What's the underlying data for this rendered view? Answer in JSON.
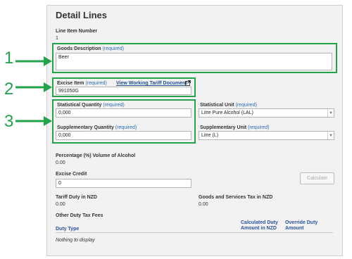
{
  "colors": {
    "annotation": "#23a34a",
    "required": "#2a6db5",
    "link": "#1f4f8f",
    "table_header": "#2a55a0"
  },
  "title": "Detail Lines",
  "line_item_number": {
    "label": "Line Item Number",
    "value": "1"
  },
  "required_text": "(required)",
  "goods_description": {
    "label": "Goods Description",
    "value": "Beer"
  },
  "excise_item": {
    "label": "Excise Item",
    "value": "991050G",
    "tariff_link": "View Working Tariff Document"
  },
  "statistical_quantity": {
    "label": "Statistical Quantity",
    "value": "0,000"
  },
  "supplementary_quantity": {
    "label": "Supplementary Quantity",
    "value": "0,000"
  },
  "statistical_unit": {
    "label": "Statistical Unit",
    "value": "Litre Pure Alcohol (LAL)"
  },
  "supplementary_unit": {
    "label": "Supplementary Unit",
    "value": "Litre (L)"
  },
  "percentage_alcohol": {
    "label": "Percentage (%) Volume of Alcohol",
    "value": "0.00"
  },
  "excise_credit": {
    "label": "Excise Credit",
    "value": "0"
  },
  "calculate_button": "Calculate",
  "tariff_duty": {
    "label": "Tariff Duty in NZD",
    "value": "0.00"
  },
  "gst": {
    "label": "Goods and Services Tax in NZD",
    "value": "0.00"
  },
  "other_duty": {
    "label": "Other Duty Tax Fees",
    "columns": [
      "Duty Type",
      "Calculated Duty",
      "Amount in NZD",
      "Override Duty",
      "Amount"
    ],
    "empty_text": "Nothing to display"
  },
  "annotations": [
    "1",
    "2",
    "3"
  ],
  "icons": {
    "external_link": "external-link-icon",
    "dropdown": "chevron-down-icon",
    "arrow": "arrow-right-icon"
  }
}
